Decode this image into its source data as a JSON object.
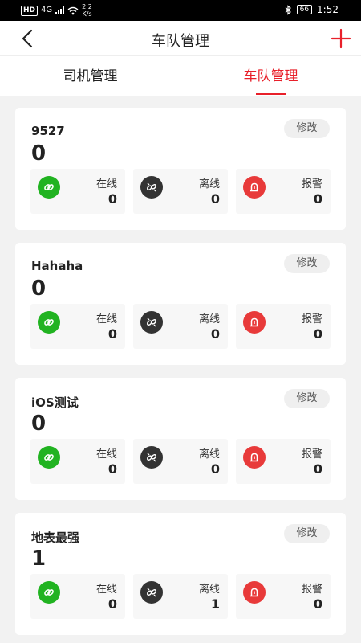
{
  "status_bar": {
    "network": "HD",
    "signal": "4G",
    "speed_value": "2.2",
    "speed_unit": "K/s",
    "battery": "66",
    "time": "1:52"
  },
  "header": {
    "title": "车队管理",
    "back_icon": "chevron-left-icon",
    "add_icon": "plus-icon"
  },
  "tabs": [
    {
      "label": "司机管理",
      "active": false
    },
    {
      "label": "车队管理",
      "active": true
    }
  ],
  "colors": {
    "accent": "#e8202a",
    "online": "#21b321",
    "offline": "#333333",
    "alarm": "#e83a3a"
  },
  "fleets": [
    {
      "name": "9527",
      "total": "0",
      "edit_label": "修改",
      "stats": [
        {
          "label": "在线",
          "value": "0"
        },
        {
          "label": "离线",
          "value": "0"
        },
        {
          "label": "报警",
          "value": "0"
        }
      ]
    },
    {
      "name": "Hahaha",
      "total": "0",
      "edit_label": "修改",
      "stats": [
        {
          "label": "在线",
          "value": "0"
        },
        {
          "label": "离线",
          "value": "0"
        },
        {
          "label": "报警",
          "value": "0"
        }
      ]
    },
    {
      "name": "iOS测试",
      "total": "0",
      "edit_label": "修改",
      "stats": [
        {
          "label": "在线",
          "value": "0"
        },
        {
          "label": "离线",
          "value": "0"
        },
        {
          "label": "报警",
          "value": "0"
        }
      ]
    },
    {
      "name": "地表最强",
      "total": "1",
      "edit_label": "修改",
      "stats": [
        {
          "label": "在线",
          "value": "0"
        },
        {
          "label": "离线",
          "value": "1"
        },
        {
          "label": "报警",
          "value": "0"
        }
      ]
    }
  ]
}
